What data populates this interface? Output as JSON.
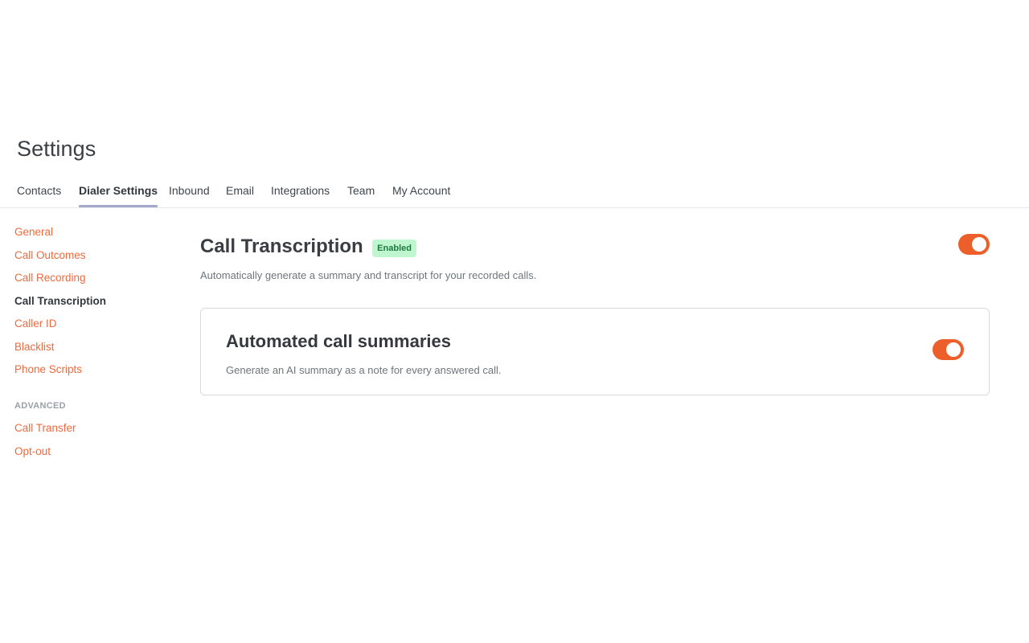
{
  "page": {
    "title": "Settings"
  },
  "tabs": [
    {
      "label": "Contacts",
      "active": false
    },
    {
      "label": "Dialer Settings",
      "active": true
    },
    {
      "label": "Inbound",
      "active": false
    },
    {
      "label": "Email",
      "active": false
    },
    {
      "label": "Integrations",
      "active": false
    },
    {
      "label": "Team",
      "active": false
    },
    {
      "label": "My Account",
      "active": false
    }
  ],
  "sidebar": {
    "items": [
      {
        "label": "General",
        "active": false
      },
      {
        "label": "Call Outcomes",
        "active": false
      },
      {
        "label": "Call Recording",
        "active": false
      },
      {
        "label": "Call Transcription",
        "active": true
      },
      {
        "label": "Caller ID",
        "active": false
      },
      {
        "label": "Blacklist",
        "active": false
      },
      {
        "label": "Phone Scripts",
        "active": false
      }
    ],
    "section_label": "ADVANCED",
    "advanced_items": [
      {
        "label": "Call Transfer",
        "active": false
      },
      {
        "label": "Opt-out",
        "active": false
      }
    ]
  },
  "main": {
    "title": "Call Transcription",
    "status_badge": "Enabled",
    "description": "Automatically generate a summary and transcript for your recorded calls.",
    "toggle_on": true,
    "card": {
      "title": "Automated call summaries",
      "description": "Generate an AI summary as a note for every answered call.",
      "toggle_on": true
    }
  },
  "colors": {
    "accent": "#ec5f2a",
    "link": "#ec6a3e",
    "badge_bg": "#bff5cf",
    "badge_text": "#1f7a3e",
    "tab_underline": "#a3a8cc"
  }
}
